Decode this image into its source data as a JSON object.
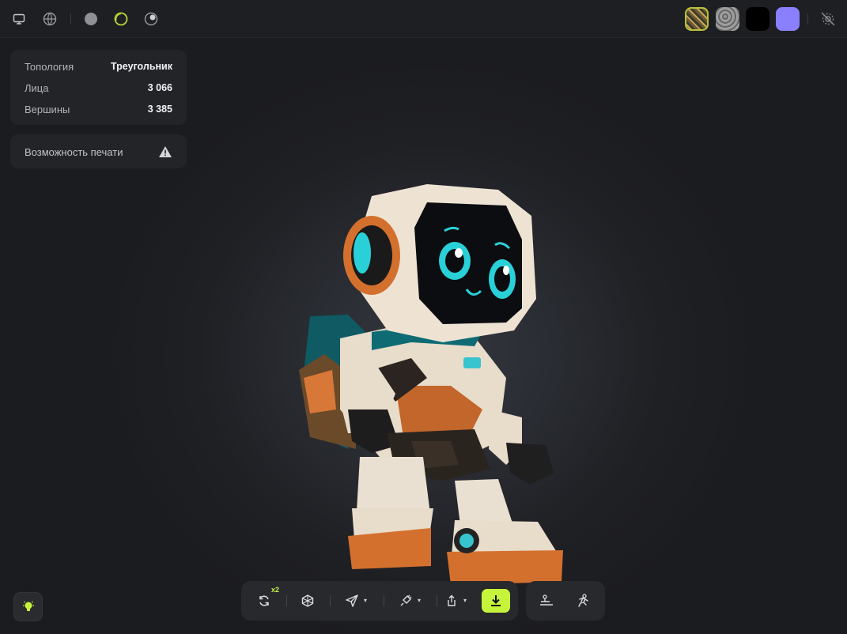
{
  "topbar": {
    "left_icons": [
      "monitor-icon",
      "globe-icon",
      "solid-sphere-icon",
      "wireframe-sphere-icon",
      "shaded-sphere-icon"
    ],
    "material_swatches": [
      {
        "name": "texture-swatch",
        "color": "#7a6a3c"
      },
      {
        "name": "noise-swatch",
        "color": "#8a8a8a"
      },
      {
        "name": "black-swatch",
        "color": "#000000"
      },
      {
        "name": "purple-swatch",
        "color": "#8a80ff"
      }
    ],
    "right_icon": "lighting-settings-icon"
  },
  "stats": {
    "topology_label": "Топология",
    "topology_value": "Треугольник",
    "faces_label": "Лица",
    "faces_value": "3 066",
    "vertices_label": "Вершины",
    "vertices_value": "3 385"
  },
  "printability": {
    "label": "Возможность печати",
    "icon": "warning-icon"
  },
  "toolbar": {
    "retry_badge": "x2",
    "accent_color": "#c6f43b",
    "buttons": [
      "retry-icon",
      "mesh-icon",
      "send-icon",
      "plugin-icon",
      "share-icon",
      "download-icon"
    ]
  },
  "toolbar2": {
    "buttons": [
      "rig-icon",
      "animate-icon"
    ]
  },
  "hint": {
    "icon": "lightbulb-icon",
    "color": "#c6f43b"
  }
}
